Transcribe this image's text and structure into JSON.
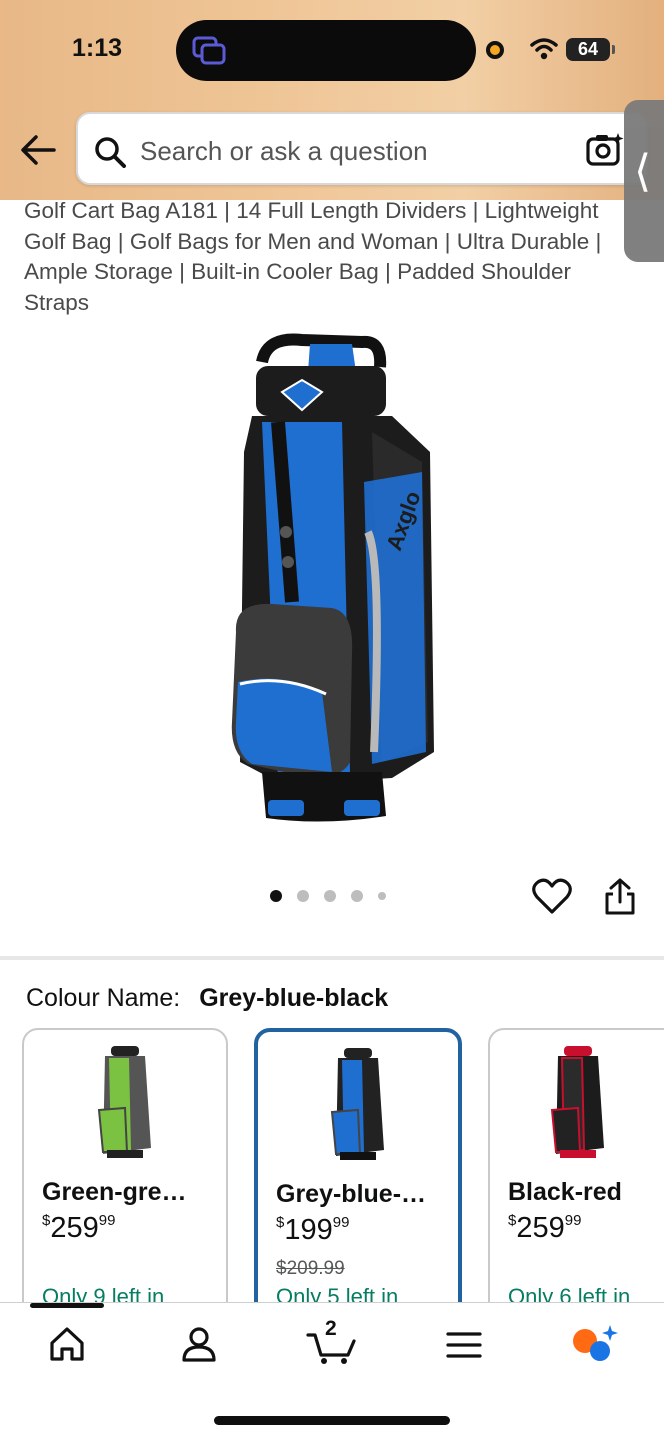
{
  "status_bar": {
    "time": "1:13",
    "battery": "64"
  },
  "search": {
    "placeholder": "Search or ask a question"
  },
  "product": {
    "title": "Golf Cart Bag A181 | 14 Full Length Dividers | Lightweight Golf Bag | Golf Bags for Men and Woman | Ultra Durable | Ample Storage | Built-in Cooler Bag | Padded Shoulder Straps",
    "image_count": 5,
    "active_image": 1
  },
  "colour": {
    "label": "Colour Name:",
    "selected": "Grey-blue-black",
    "options": [
      {
        "name": "Green-gre…",
        "currency": "$",
        "price_whole": "259",
        "price_fraction": "99",
        "was_price": "",
        "stock": "Only 9 left in",
        "accent": "#7cc242"
      },
      {
        "name": "Grey-blue-…",
        "currency": "$",
        "price_whole": "199",
        "price_fraction": "99",
        "was_price": "$209.99",
        "stock": "Only 5 left in",
        "accent": "#1f6fd1"
      },
      {
        "name": "Black-red",
        "currency": "$",
        "price_whole": "259",
        "price_fraction": "99",
        "was_price": "",
        "stock": "Only 6 left in",
        "accent": "#c8102e"
      }
    ]
  },
  "bottom_nav": {
    "cart_count": "2",
    "items": [
      "home-icon",
      "account-icon",
      "cart-icon",
      "menu-icon",
      "rufus-icon"
    ]
  },
  "colors": {
    "header_bg": "#efc596",
    "selected_border": "#2162a1",
    "stock_green": "#067d62"
  }
}
